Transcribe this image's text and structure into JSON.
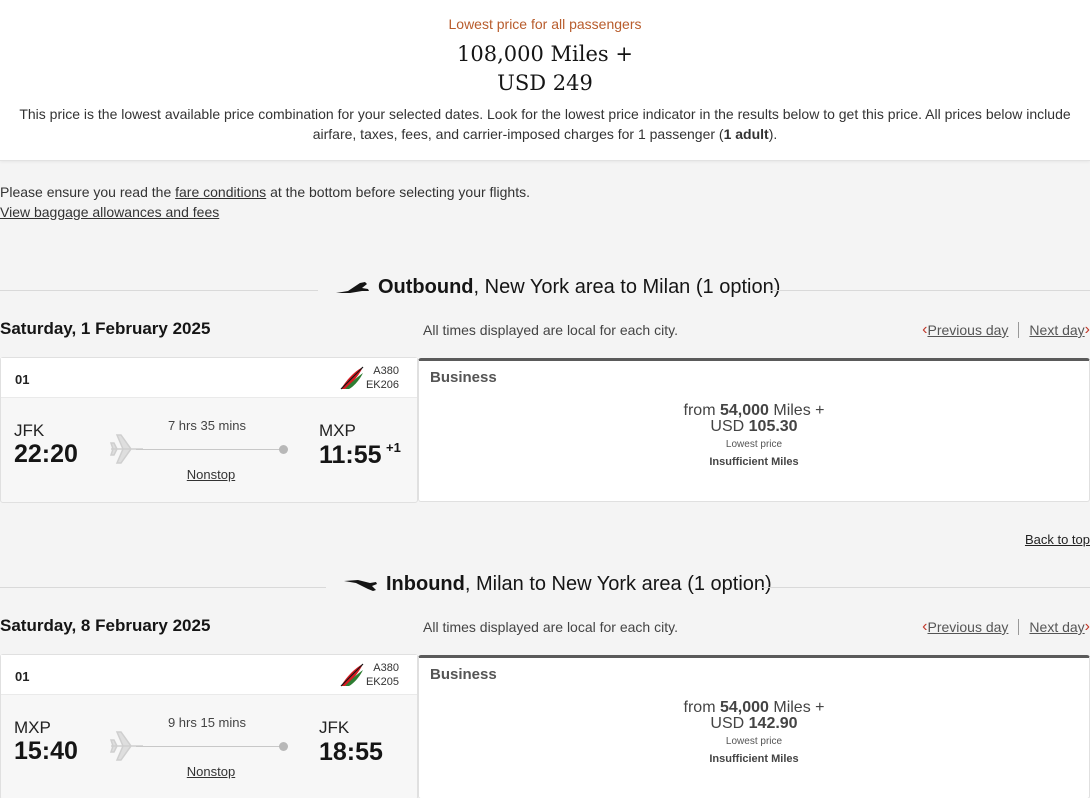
{
  "summary": {
    "label": "Lowest price for all passengers",
    "miles": "108,000 Miles +",
    "usd": "USD 249",
    "text_before": "This price is the lowest available price combination for your selected dates. Look for the lowest price indicator in the results below to get this price. All prices below include airfare, taxes, fees, and carrier-imposed charges for 1 passenger (",
    "text_bold": "1 adult",
    "text_after": ")."
  },
  "notice": {
    "line1_before": "Please ensure you read the ",
    "line1_link": "fare conditions",
    "line1_after": " at the bottom before selecting your flights.",
    "line2_link": "View baggage allowances and fees"
  },
  "outbound": {
    "title_bold": "Outbound",
    "title_rest": ", New York area to Milan (1 option)",
    "date": "Saturday, 1 February 2025",
    "times_note": "All times displayed are local for each city.",
    "prev_day": "Previous day",
    "next_day": "Next day",
    "flight": {
      "number": "01",
      "aircraft": "A380",
      "flight_code": "EK206",
      "from_code": "JFK",
      "from_time": "22:20",
      "duration": "7 hrs 35 mins",
      "stops": "Nonstop",
      "to_code": "MXP",
      "to_time": "11:55",
      "day_offset": "+1"
    },
    "fare": {
      "cabin": "Business",
      "from_word": "from",
      "miles_value": "54,000",
      "miles_word": "Miles +",
      "usd_word": "USD",
      "usd_value": "105.30",
      "lowest": "Lowest price",
      "status": "Insufficient Miles"
    }
  },
  "back_to_top": "Back to top",
  "inbound": {
    "title_bold": "Inbound",
    "title_rest": ", Milan to New York area (1 option)",
    "date": "Saturday, 8 February 2025",
    "times_note": "All times displayed are local for each city.",
    "prev_day": "Previous day",
    "next_day": "Next day",
    "flight": {
      "number": "01",
      "aircraft": "A380",
      "flight_code": "EK205",
      "from_code": "MXP",
      "from_time": "15:40",
      "duration": "9 hrs 15 mins",
      "stops": "Nonstop",
      "to_code": "JFK",
      "to_time": "18:55"
    },
    "fare": {
      "cabin": "Business",
      "from_word": "from",
      "miles_value": "54,000",
      "miles_word": "Miles +",
      "usd_word": "USD",
      "usd_value": "142.90",
      "lowest": "Lowest price",
      "status": "Insufficient Miles"
    }
  },
  "colors": {
    "accent_label": "#b85c2c",
    "chevron": "#c0392b",
    "logo_red": "#d71a21",
    "logo_green": "#2e7d32"
  },
  "icons": {
    "takeoff": "airplane-takeoff-icon",
    "landing": "airplane-landing-icon",
    "route_plane": "airplane-icon",
    "airline_logo": "emirates-logo"
  }
}
